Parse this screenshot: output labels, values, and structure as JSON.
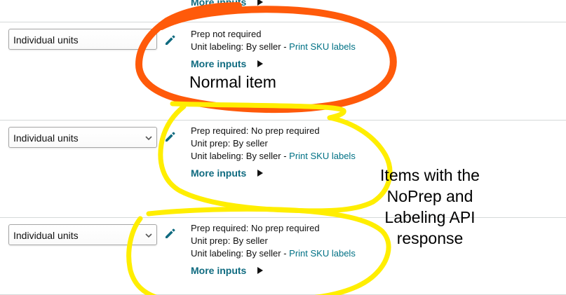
{
  "top_partial": {
    "more_inputs_label": "More inputs"
  },
  "rows": [
    {
      "unit_select_value": "Individual units",
      "lines": [
        {
          "text": "Prep not required",
          "style": "plain"
        }
      ],
      "labeling_prefix": "Unit labeling: By seller - ",
      "labeling_link": "Print SKU labels",
      "more_inputs_label": "More inputs"
    },
    {
      "unit_select_value": "Individual units",
      "lines": [
        {
          "text": "Prep required: No prep required",
          "style": "teal"
        },
        {
          "text": "Unit prep: By seller",
          "style": "plain"
        }
      ],
      "labeling_prefix": "Unit labeling: By seller - ",
      "labeling_link": "Print SKU labels",
      "more_inputs_label": "More inputs"
    },
    {
      "unit_select_value": "Individual units",
      "lines": [
        {
          "text": "Prep required: No prep required",
          "style": "teal"
        },
        {
          "text": "Unit prep: By seller",
          "style": "plain"
        }
      ],
      "labeling_prefix": "Unit labeling: By seller - ",
      "labeling_link": "Print SKU labels",
      "more_inputs_label": "More inputs"
    }
  ],
  "annotations": {
    "normal_item": "Normal item",
    "noprep_lines": [
      "Items with the",
      "NoPrep and",
      "Labeling API",
      "response"
    ],
    "colors": {
      "orange": "#ff5a0a",
      "yellow": "#ffee00"
    }
  },
  "icons": {
    "edit": "pencil-icon",
    "dropdown": "chevron-down-icon",
    "expand": "play-triangle-icon"
  }
}
